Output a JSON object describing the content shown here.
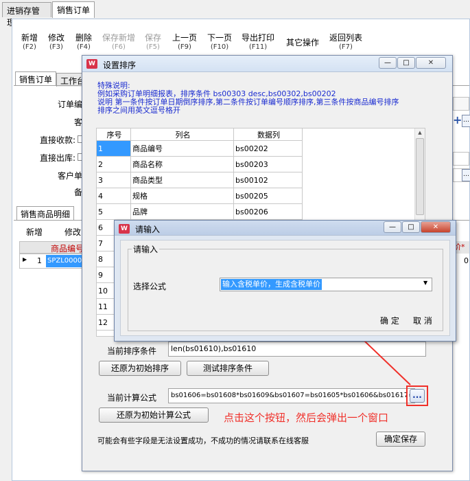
{
  "top_tabs": [
    "进销存管理",
    "销售订单"
  ],
  "toolbar": [
    {
      "label": "新增",
      "key": "(F2)",
      "enabled": true
    },
    {
      "label": "修改",
      "key": "(F3)",
      "enabled": true
    },
    {
      "label": "删除",
      "key": "(F4)",
      "enabled": true
    },
    {
      "label": "保存新增",
      "key": "(F6)",
      "enabled": false
    },
    {
      "label": "保存",
      "key": "(F5)",
      "enabled": false
    },
    {
      "label": "上一页",
      "key": "(F9)",
      "enabled": true
    },
    {
      "label": "下一页",
      "key": "(F10)",
      "enabled": true
    },
    {
      "label": "导出打印",
      "key": "(F11)",
      "enabled": true
    },
    {
      "label": "其它操作",
      "key": "",
      "enabled": true
    },
    {
      "label": "返回列表",
      "key": "(F7)",
      "enabled": true
    }
  ],
  "sub_tabs": [
    "销售订单",
    "工作台"
  ],
  "form_labels": [
    "订单编",
    "客",
    "直接收款:",
    "直接出库:",
    "客户单",
    "备"
  ],
  "detail_tab": "销售商品明细",
  "detail_buttons": [
    "新增",
    "修改"
  ],
  "detail_grid": {
    "header": "商品编号",
    "row_index": "1",
    "row_value": "SPZL00002",
    "right_header": "价*",
    "right_value": "0"
  },
  "sort_dialog": {
    "title": "设置排序",
    "note_lines": [
      "特殊说明:",
      "例如采购订单明细报表，排序条件 bs00303 desc,bs00302,bs00202",
      "说明 第一条件按订单日期倒序排序,第二条件按订单编号顺序排序,第三条件按商品编号排序",
      "排序之间用英文逗号格开"
    ],
    "columns": [
      "序号",
      "列名",
      "数据列"
    ],
    "rows": [
      [
        "1",
        "商品编号",
        "bs00202"
      ],
      [
        "2",
        "商品名称",
        "bs00203"
      ],
      [
        "3",
        "商品类型",
        "bs00102"
      ],
      [
        "4",
        "规格",
        "bs00205"
      ],
      [
        "5",
        "品牌",
        "bs00206"
      ],
      [
        "6",
        "",
        ""
      ],
      [
        "7",
        "",
        ""
      ],
      [
        "8",
        "",
        ""
      ],
      [
        "9",
        "",
        ""
      ],
      [
        "10",
        "",
        ""
      ],
      [
        "11",
        "",
        ""
      ],
      [
        "12",
        "",
        ""
      ]
    ],
    "current_sort_label": "当前排序条件",
    "current_sort_value": "len(bs01610),bs01610",
    "restore_sort_button": "还原为初始排序",
    "test_sort_button": "测试排序条件",
    "current_formula_label": "当前计算公式",
    "current_formula_value": "bs01606=bs01608*bs01609&bs01607=bs01605*bs01606&bs01617=bs0",
    "ellipsis_button": "...",
    "restore_formula_button": "还原为初始计算公式",
    "footer_note": "可能会有些字段是无法设置成功，不成功的情况请联系在线客服",
    "confirm_save_button": "确定保存"
  },
  "input_dialog": {
    "title": "请输入",
    "group_label": "请输入",
    "field_label": "选择公式",
    "select_value": "输入含税单价，生成含税单价",
    "ok_button": "确 定",
    "cancel_button": "取 消"
  },
  "annotation": "点击这个按钮，然后会弹出一个窗口",
  "colors": {
    "note_blue": "#1a2bd0",
    "annotation_red": "#f0302a",
    "selection_blue": "#3399ff"
  }
}
